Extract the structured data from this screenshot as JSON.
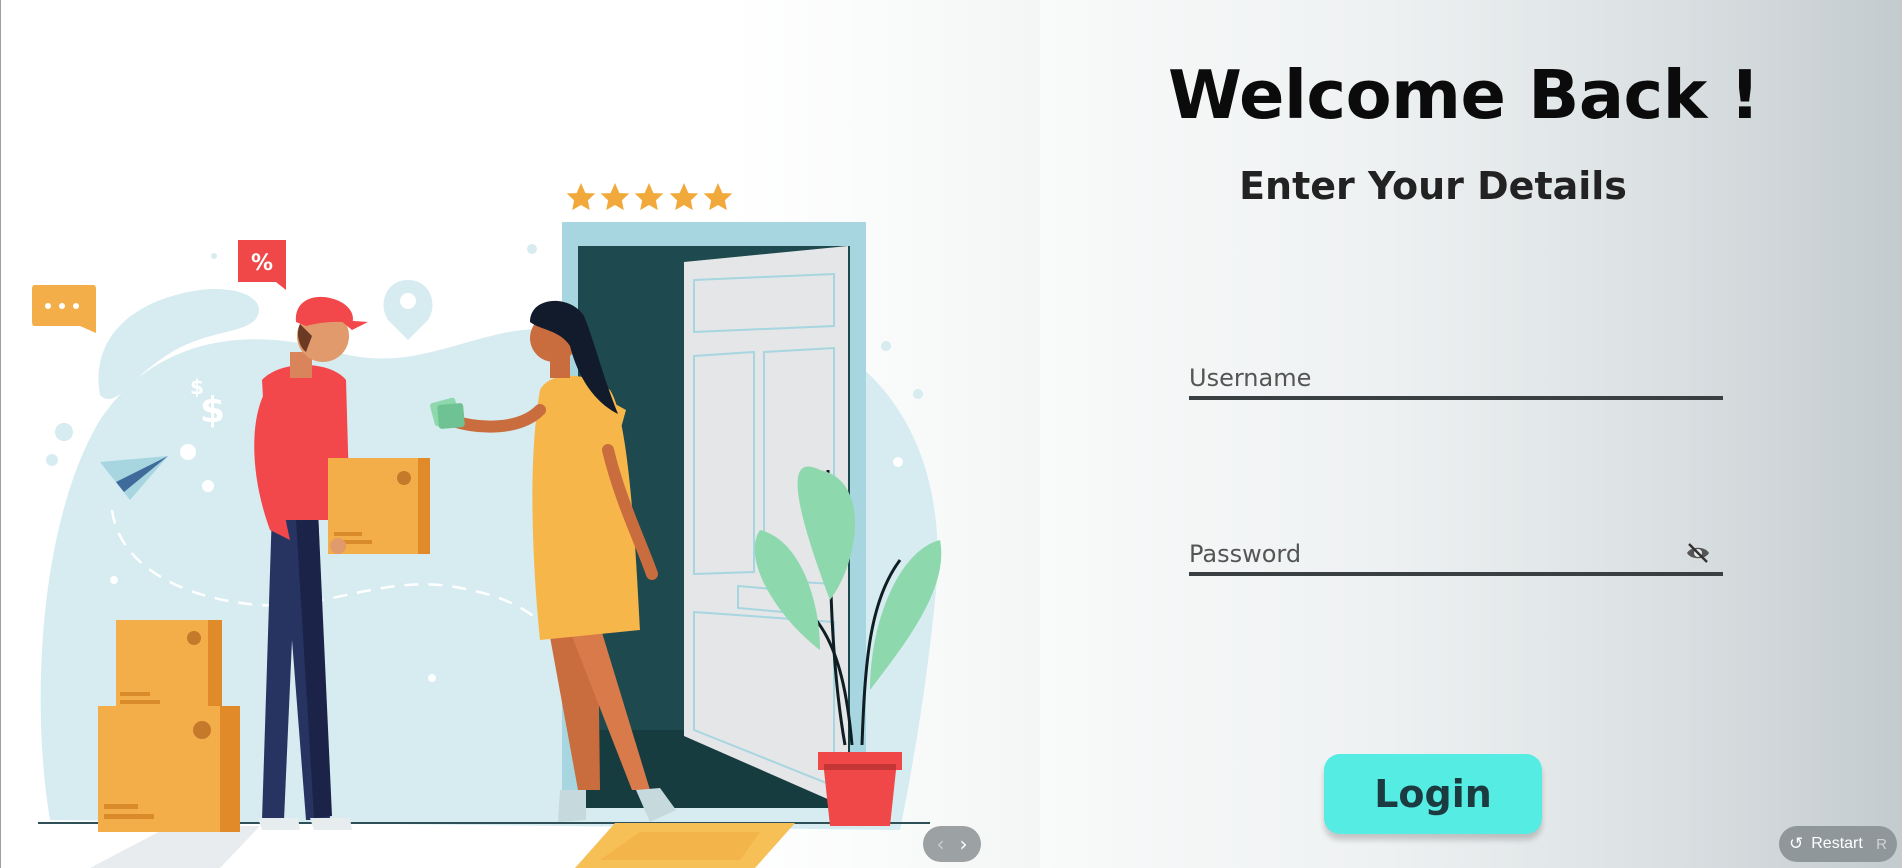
{
  "header": {
    "title": "Welcome Back !",
    "subtitle": "Enter Your Details"
  },
  "form": {
    "username": {
      "placeholder": "Username",
      "value": ""
    },
    "password": {
      "placeholder": "Password",
      "value": ""
    },
    "login_label": "Login"
  },
  "illustration": {
    "badge_text": "%",
    "currency_text": "$",
    "rating_stars": 5
  },
  "nav": {
    "prev": "‹",
    "next": "›"
  },
  "restart": {
    "icon": "↺",
    "label": "Restart",
    "key": "R"
  },
  "icons": [
    "eye-off-icon",
    "restart-icon",
    "chevron-left-icon",
    "chevron-right-icon",
    "star-icon",
    "location-pin-icon",
    "chat-bubble-icon",
    "paper-plane-icon"
  ],
  "colors": {
    "accent": "#55ece3",
    "login_text": "#1b3b40",
    "underline": "#3a3f41",
    "star": "#f2a93b",
    "box": "#f3ae4a",
    "blob": "#d6ecf0",
    "door_frame": "#a7d6e0",
    "door_inner": "#1e4a4f",
    "pot": "#f04848",
    "leaf": "#8ed8ad"
  }
}
